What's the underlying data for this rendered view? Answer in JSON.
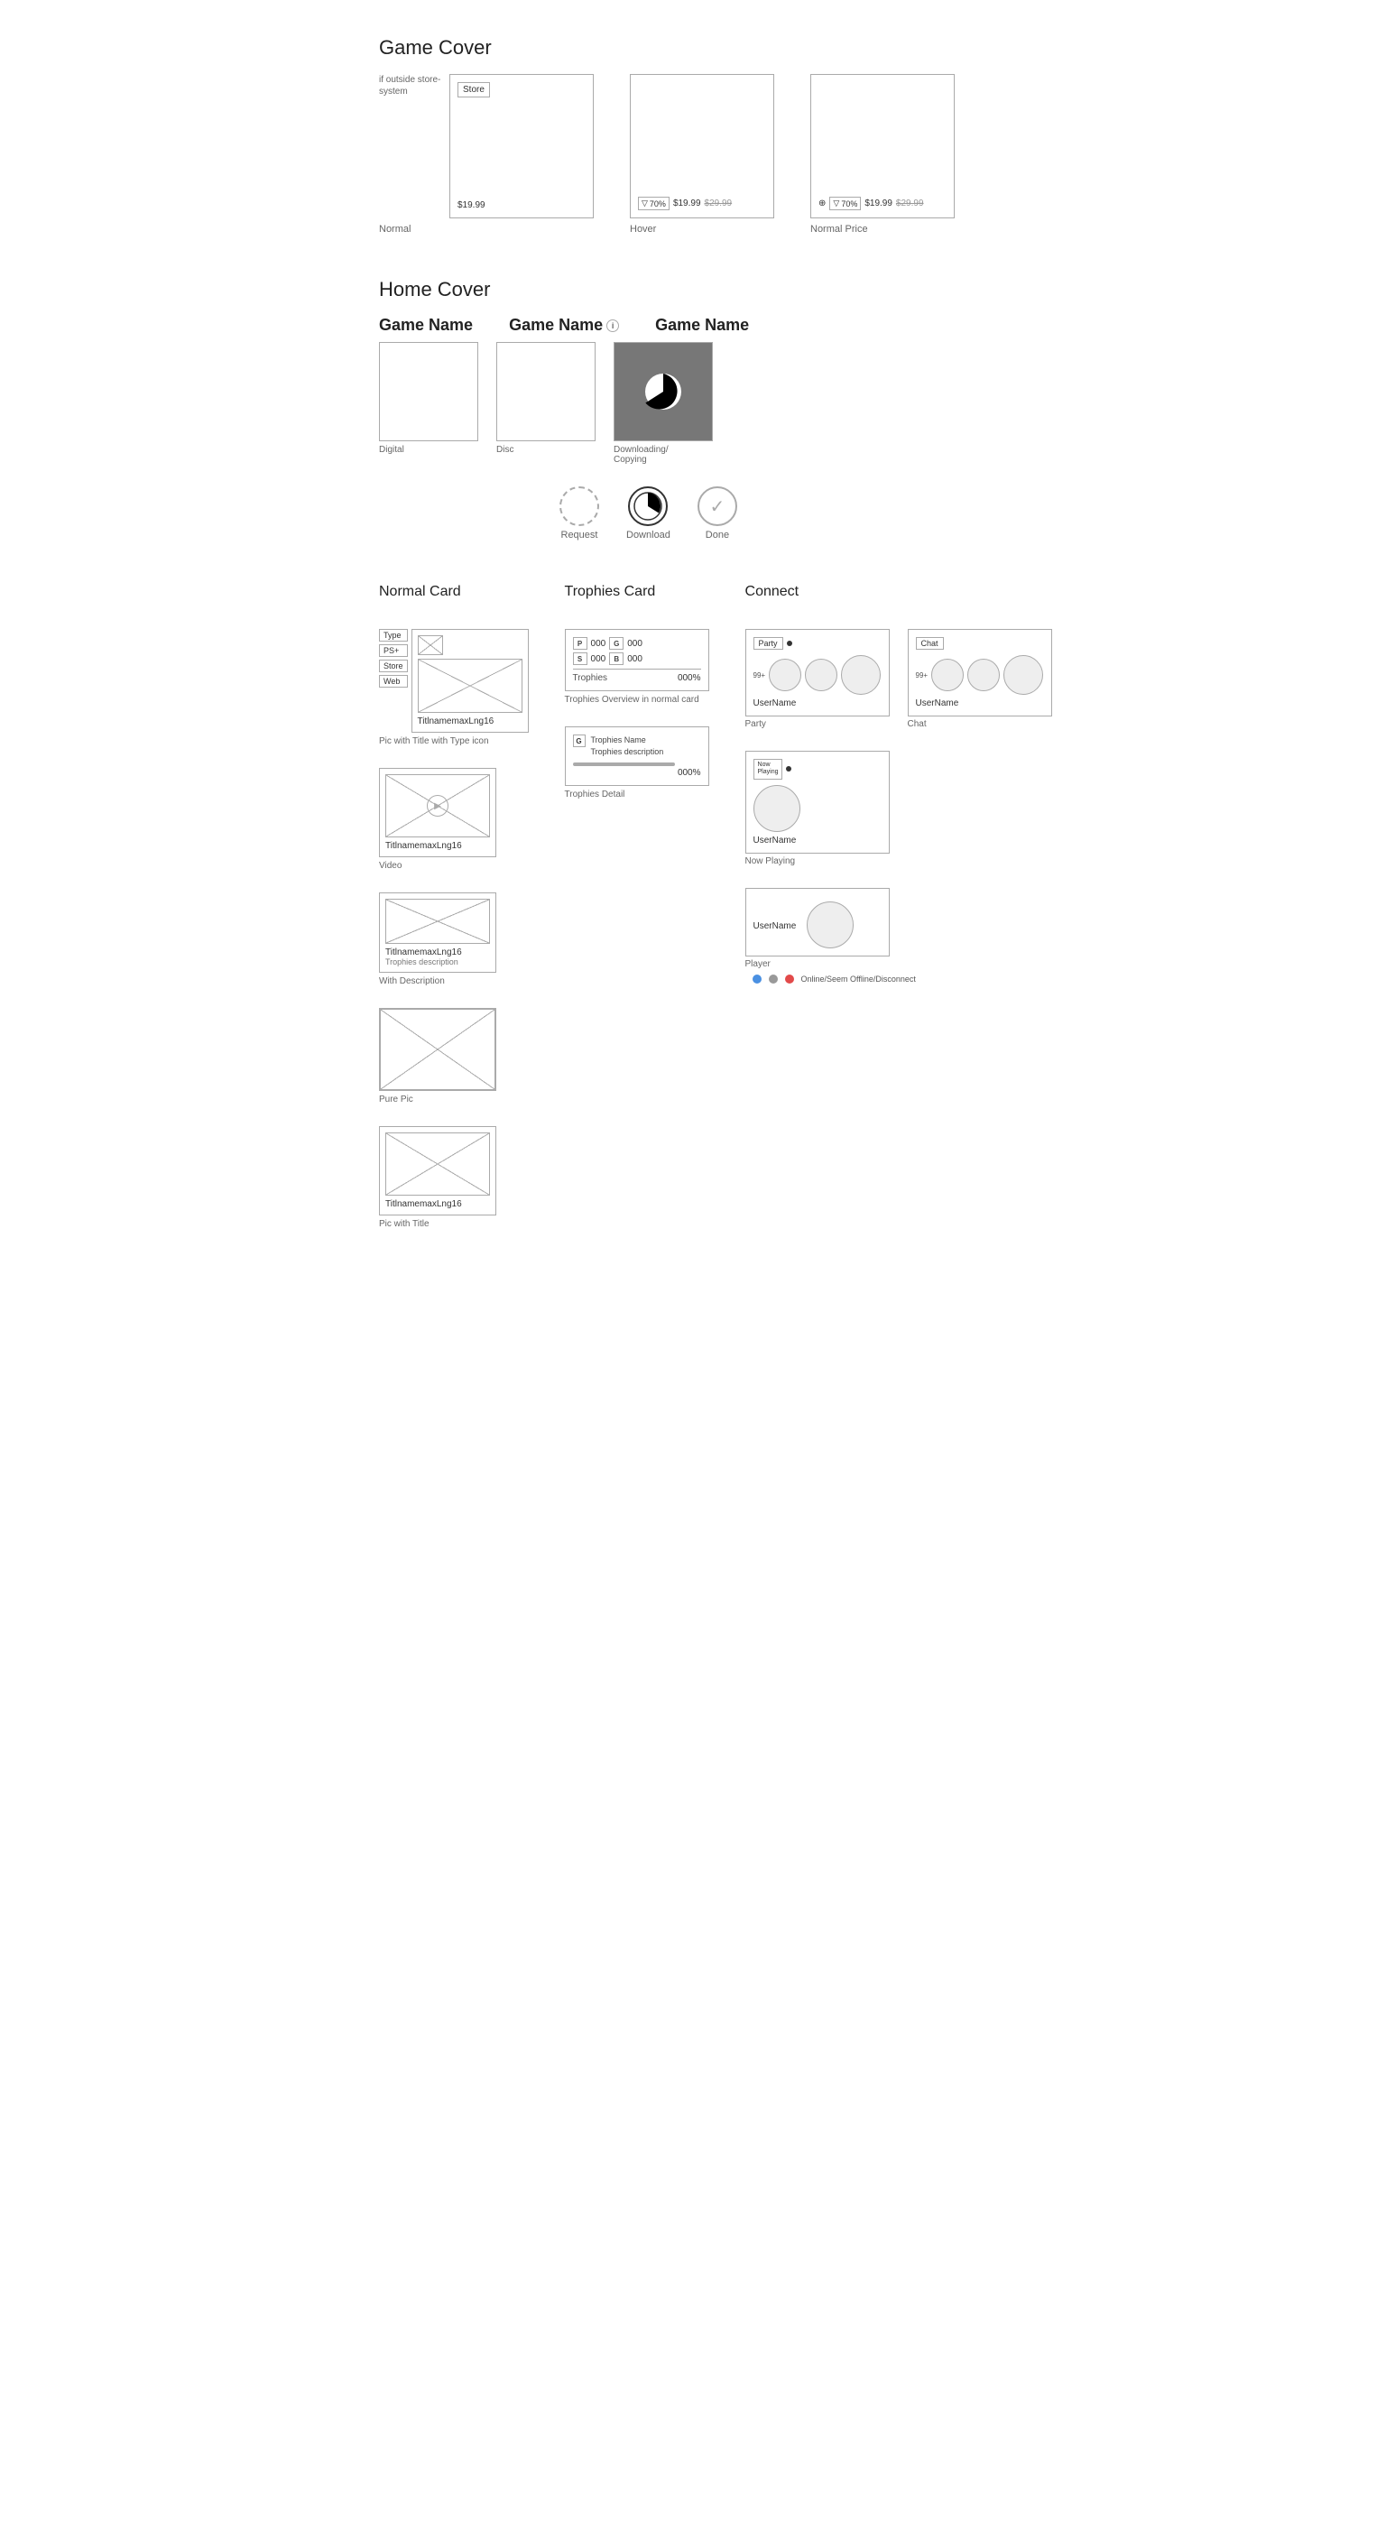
{
  "page": {
    "bg": "#ffffff"
  },
  "gameCover": {
    "title": "Game Cover",
    "outsideLabel": "if outside store-system",
    "normal": {
      "storeBadge": "Store",
      "price": "$19.99",
      "caption": "Normal"
    },
    "hover": {
      "discountPct": "70%",
      "price": "$19.99",
      "originalPrice": "$29.99",
      "caption": "Hover"
    },
    "normalPrice": {
      "giftIcon": "⊕",
      "discountPct": "70%",
      "price": "$19.99",
      "originalPrice": "$29.99",
      "caption": "Normal Price"
    }
  },
  "homeCover": {
    "title": "Home Cover",
    "gameName1": "Game Name",
    "gameName2": "Game Name",
    "gameName2Icon": "i",
    "gameName3": "Game Name",
    "digital": {
      "caption": "Digital"
    },
    "disc": {
      "caption": "Disc"
    },
    "downloading": {
      "caption": "Downloading/\nCopying"
    },
    "statusIcons": {
      "request": {
        "label": "Request"
      },
      "download": {
        "label": "Download"
      },
      "done": {
        "label": "Done",
        "check": "✓"
      }
    }
  },
  "normalCard": {
    "title": "Normal Card",
    "typeLabel": "Type",
    "ps": "PS+",
    "store": "Store",
    "web": "Web",
    "picWithTitle": {
      "title": "TitlnamemaxLng16",
      "caption": "Pic with Title with Type icon"
    },
    "video": {
      "title": "TitlnamemaxLng16",
      "caption": "Video"
    },
    "withDesc": {
      "title": "TitlnamemaxLng16",
      "desc": "Trophies description",
      "caption": "With Description"
    },
    "purePic": {
      "caption": "Pure Pic"
    },
    "picWithTitleOnly": {
      "title": "TitlnamemaxLng16",
      "caption": "Pic with Title"
    }
  },
  "trophiesCard": {
    "title": "Trophies Card",
    "overview": {
      "p": "P",
      "g": "G",
      "s": "S",
      "b": "B",
      "pCount": "000",
      "gCount": "000",
      "sCount": "000",
      "bCount": "000",
      "trophiesLabel": "Trophies",
      "percent": "000%",
      "caption": "Trophies Overview in normal card"
    },
    "detail": {
      "g": "G",
      "name": "Trophies Name",
      "desc": "Trophies description",
      "percent": "000%",
      "caption": "Trophies Detail"
    }
  },
  "connect": {
    "title": "Connect",
    "party": {
      "label": "Party",
      "dot": true,
      "count": "99+",
      "username": "UserName",
      "caption": "Party"
    },
    "chat": {
      "label": "Chat",
      "count": "99+",
      "username": "UserName",
      "caption": "Chat"
    },
    "nowPlaying": {
      "label": "Now\nPlaying",
      "dot": true,
      "username": "UserName",
      "caption": "Now Playing"
    },
    "player": {
      "username": "UserName",
      "caption": "Player",
      "statusLabel": "Online/Seem Offline/Disconnect"
    }
  }
}
